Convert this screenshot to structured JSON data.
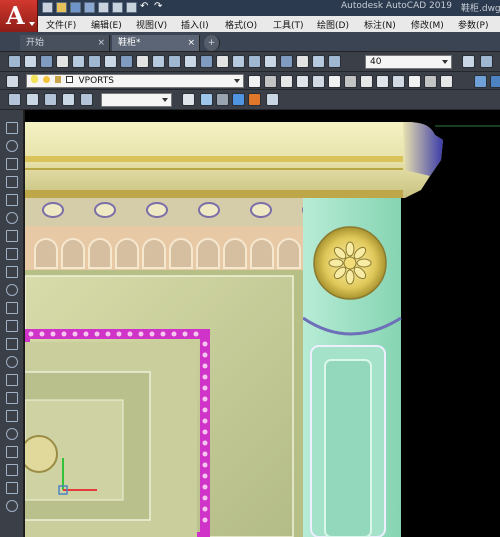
{
  "window": {
    "app_title": "Autodesk AutoCAD 2019",
    "file_title": "鞋柜.dwg"
  },
  "app_button": {
    "letter": "A"
  },
  "menu": {
    "items": [
      "文件(F)",
      "编辑(E)",
      "视图(V)",
      "插入(I)",
      "格式(O)",
      "工具(T)",
      "绘图(D)",
      "标注(N)",
      "修改(M)",
      "参数(P)"
    ]
  },
  "tabs": {
    "start": "开始",
    "doc": "鞋柜*",
    "close": "×",
    "new": "+"
  },
  "toolbar": {
    "layer_name": "VPORTS",
    "text_height": "40"
  },
  "colors": {
    "cabinet_frame": "#eee9b4",
    "gold_band": "#d9c35a",
    "pillar": "#9fe0c4",
    "panel": "#c7cc9a",
    "magenta_molding": "#cf33c8",
    "background": "#000000",
    "ucs_x": "#e53b3b",
    "ucs_y": "#35c23a"
  }
}
